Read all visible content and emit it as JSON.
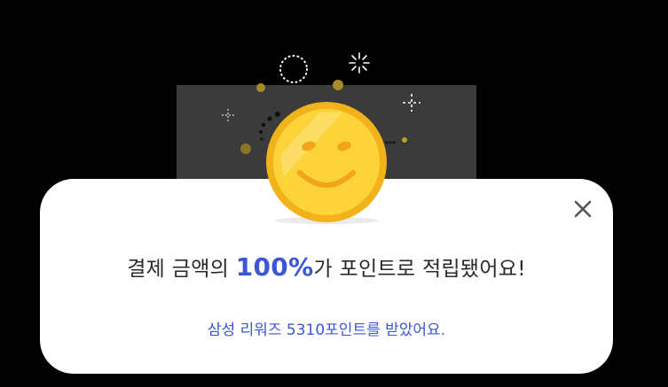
{
  "reward": {
    "title_prefix": "결제 금액의 ",
    "title_percent": "100%",
    "title_suffix": "가 포인트로 적립됐어요!",
    "subtitle": "삼성 리워즈 5310포인트를 받았어요."
  },
  "icons": {
    "close": "close-icon",
    "coin": "smiley-coin-icon"
  },
  "colors": {
    "accent": "#3b57d6",
    "coin": "#f5b800",
    "card": "#ffffff",
    "overlay": "#000000"
  }
}
